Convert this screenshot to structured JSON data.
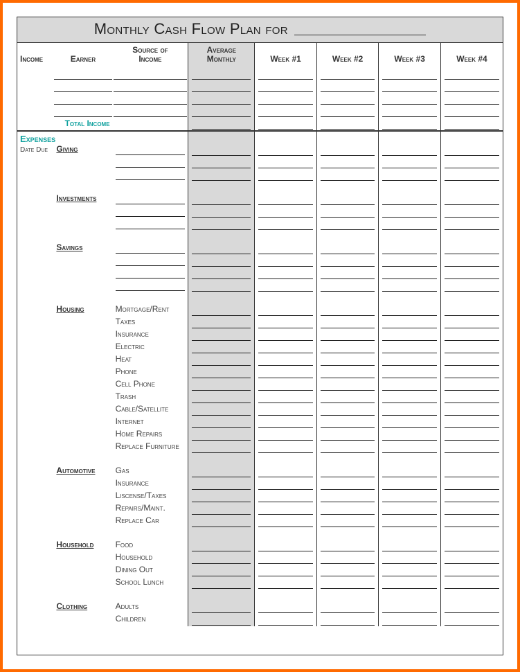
{
  "title": "Monthly Cash Flow Plan for",
  "columns": {
    "income_label": "Income",
    "earner": "Earner",
    "source_top": "Source of",
    "source_bot": "Income",
    "average_top": "Average",
    "average_bot": "Monthly",
    "week1": "Week #1",
    "week2": "Week #2",
    "week3": "Week #3",
    "week4": "Week #4"
  },
  "total_income": "Total Income",
  "expenses_label": "Expenses",
  "date_due": "Date Due",
  "categories": [
    {
      "name": "Giving",
      "items": [
        "",
        "",
        ""
      ]
    },
    {
      "name": "Investments",
      "items": [
        "",
        "",
        ""
      ]
    },
    {
      "name": "Savings",
      "items": [
        "",
        "",
        "",
        ""
      ]
    },
    {
      "name": "Housing",
      "items": [
        "Mortgage/Rent",
        "Taxes",
        "Insurance",
        "Electric",
        "Heat",
        "Phone",
        "Cell Phone",
        "Trash",
        "Cable/Satellite",
        "Internet",
        "Home Repairs",
        "Replace Furniture"
      ]
    },
    {
      "name": "Automotive",
      "items": [
        "Gas",
        "Insurance",
        "Liscense/Taxes",
        "Repairs/Maint.",
        "Replace Car"
      ]
    },
    {
      "name": "Household",
      "items": [
        "Food",
        "Household",
        "Dining Out",
        "School Lunch"
      ]
    },
    {
      "name": "Clothing",
      "items": [
        "Adults",
        "Children"
      ]
    }
  ]
}
